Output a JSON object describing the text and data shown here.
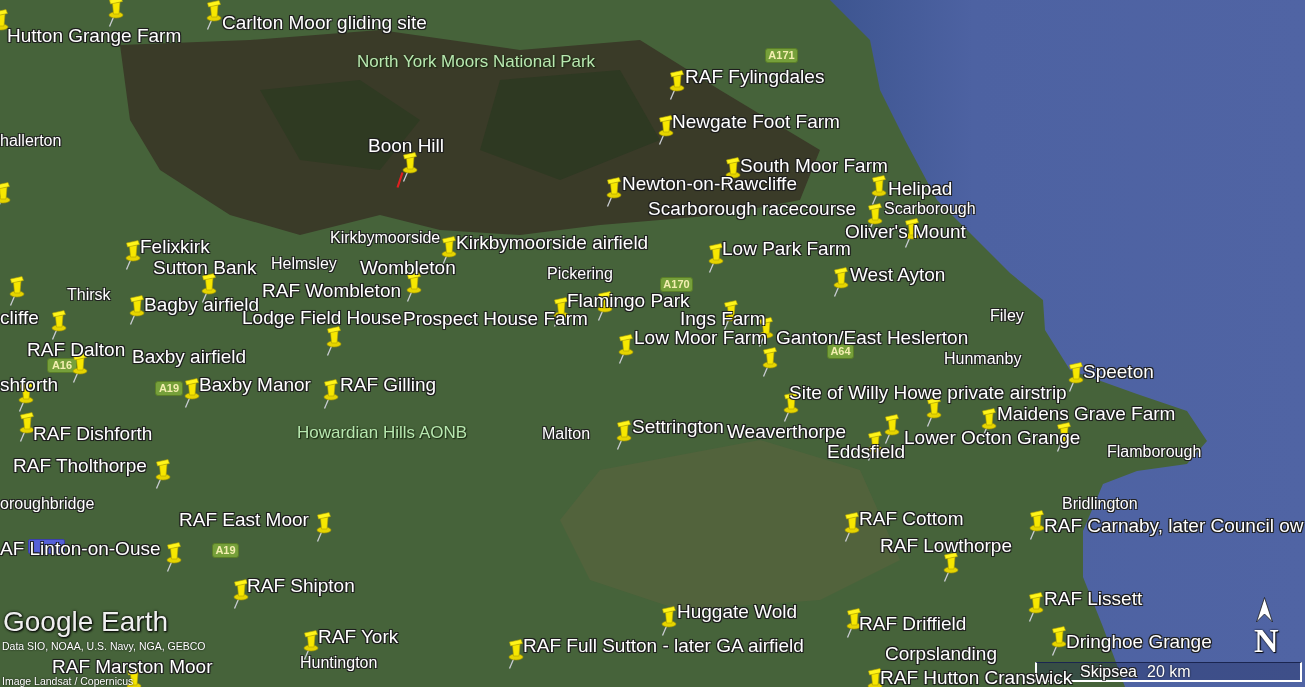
{
  "map": {
    "placemarks": [
      {
        "label": "Carlton Moor gliding site"
      },
      {
        "label": "Hutton Grange Farm"
      },
      {
        "label": "RAF Fylingdales"
      },
      {
        "label": "Newgate Foot Farm"
      },
      {
        "label": "Boon Hill"
      },
      {
        "label": "South Moor Farm"
      },
      {
        "label": "Newton-on-Rawcliffe"
      },
      {
        "label": "Helipad"
      },
      {
        "label": "Scarborough racecourse"
      },
      {
        "label": "Oliver's Mount"
      },
      {
        "label": "Felixkirk"
      },
      {
        "label": "Kirkbymoorside airfield"
      },
      {
        "label": "Low Park Farm"
      },
      {
        "label": "Sutton Bank"
      },
      {
        "label": "Wombleton"
      },
      {
        "label": "West Ayton"
      },
      {
        "label": "RAF Wombleton"
      },
      {
        "label": "Bagby airfield"
      },
      {
        "label": "Flamingo Park"
      },
      {
        "label": "cliffe"
      },
      {
        "label": "Lodge Field House"
      },
      {
        "label": "Prospect House Farm"
      },
      {
        "label": "Ings Farm"
      },
      {
        "label": "Low Moor Farm"
      },
      {
        "label": "Ganton/East Heslerton"
      },
      {
        "label": "RAF Dalton"
      },
      {
        "label": "Baxby airfield"
      },
      {
        "label": "Speeton"
      },
      {
        "label": "shforth"
      },
      {
        "label": "Baxby Manor"
      },
      {
        "label": "RAF Gilling"
      },
      {
        "label": "Site of Willy Howe private airstrip"
      },
      {
        "label": "Maidens Grave Farm"
      },
      {
        "label": "RAF Dishforth"
      },
      {
        "label": "Settrington"
      },
      {
        "label": "Weaverthorpe"
      },
      {
        "label": "Lower Octon Grange"
      },
      {
        "label": "Eddsfield"
      },
      {
        "label": "RAF Tholthorpe"
      },
      {
        "label": "RAF East Moor"
      },
      {
        "label": "RAF Cottom"
      },
      {
        "label": "RAF Carnaby, later Council ow"
      },
      {
        "label": "AF Linton-on-Ouse"
      },
      {
        "label": "RAF Lowthorpe"
      },
      {
        "label": "RAF Shipton"
      },
      {
        "label": "RAF Lissett"
      },
      {
        "label": "Huggate Wold"
      },
      {
        "label": "RAF Driffield"
      },
      {
        "label": "RAF York"
      },
      {
        "label": "RAF Full Sutton - later GA airfield"
      },
      {
        "label": "Dringhoe Grange"
      },
      {
        "label": "Corpslanding"
      },
      {
        "label": "RAF Marston Moor"
      },
      {
        "label": "RAF Hutton Cranswick"
      }
    ],
    "towns": [
      {
        "name": "hallerton"
      },
      {
        "name": "Scarborough"
      },
      {
        "name": "Kirkbymoorside"
      },
      {
        "name": "Helmsley"
      },
      {
        "name": "Pickering"
      },
      {
        "name": "Thirsk"
      },
      {
        "name": "Filey"
      },
      {
        "name": "Hunmanby"
      },
      {
        "name": "Malton"
      },
      {
        "name": "Flamborough"
      },
      {
        "name": "oroughbridge"
      },
      {
        "name": "Bridlington"
      },
      {
        "name": "Huntington"
      },
      {
        "name": "Skipsea"
      }
    ],
    "areas": [
      {
        "name": "North York Moors National Park"
      },
      {
        "name": "Howardian Hills AONB"
      }
    ],
    "road_shields": [
      {
        "label": "A171"
      },
      {
        "label": "A170"
      },
      {
        "label": "A64"
      },
      {
        "label": "A16"
      },
      {
        "label": "A19"
      },
      {
        "label": "A19"
      }
    ],
    "logo": "Google Earth",
    "attribution": [
      "Data SIO, NOAA, U.S. Navy, NGA, GEBCO",
      "Image Landsat / Copernicus"
    ],
    "scale_bar": {
      "label": "20 km"
    },
    "north_arrow": {
      "label": "N"
    }
  }
}
